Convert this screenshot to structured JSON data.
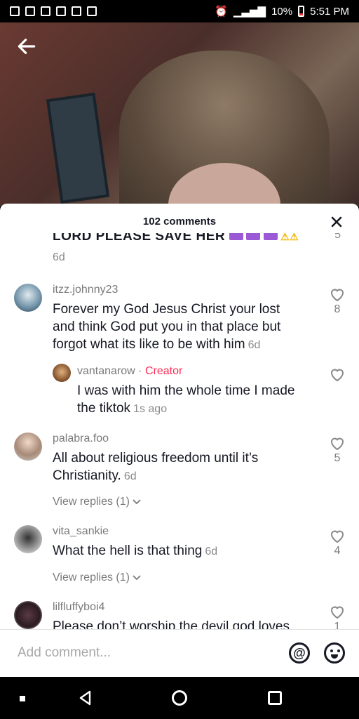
{
  "status_bar": {
    "battery": "10%",
    "time": "5:51 PM"
  },
  "sheet": {
    "title": "102 comments"
  },
  "clipped_comment": {
    "text": "LORD PLEASE SAVE HER",
    "likes": "5",
    "age": "6d"
  },
  "comments": [
    {
      "username": "itzz.johnny23",
      "text": "Forever my God Jesus Christ your lost and think God put you in that place but forgot what its like to be with him",
      "age": "6d",
      "likes": "8"
    },
    {
      "username": "vantanarow",
      "separator": "·",
      "badge": "Creator",
      "text": "I was with him the whole time I made the tiktok",
      "age": "1s ago",
      "likes": ""
    },
    {
      "username": "palabra.foo",
      "text": "All about religious freedom until it’s Christianity.",
      "age": "6d",
      "likes": "5",
      "view_replies": "View replies (1)"
    },
    {
      "username": "vita_sankie",
      "text": "What the hell is that thing",
      "age": "6d",
      "likes": "4",
      "view_replies": "View replies (1)"
    },
    {
      "username": "lilfluffyboi4",
      "text": "Please don’t worship the devil god loves",
      "likes": "1"
    }
  ],
  "input": {
    "placeholder": "Add comment..."
  },
  "icons": {
    "back": "arrow-left-icon",
    "close": "close-icon",
    "like": "heart-outline-icon",
    "mention": "at-icon",
    "emoji": "emoji-icon"
  },
  "colors": {
    "creator": "#fe2c55",
    "text": "#161823",
    "muted": "#7a7a7a"
  }
}
